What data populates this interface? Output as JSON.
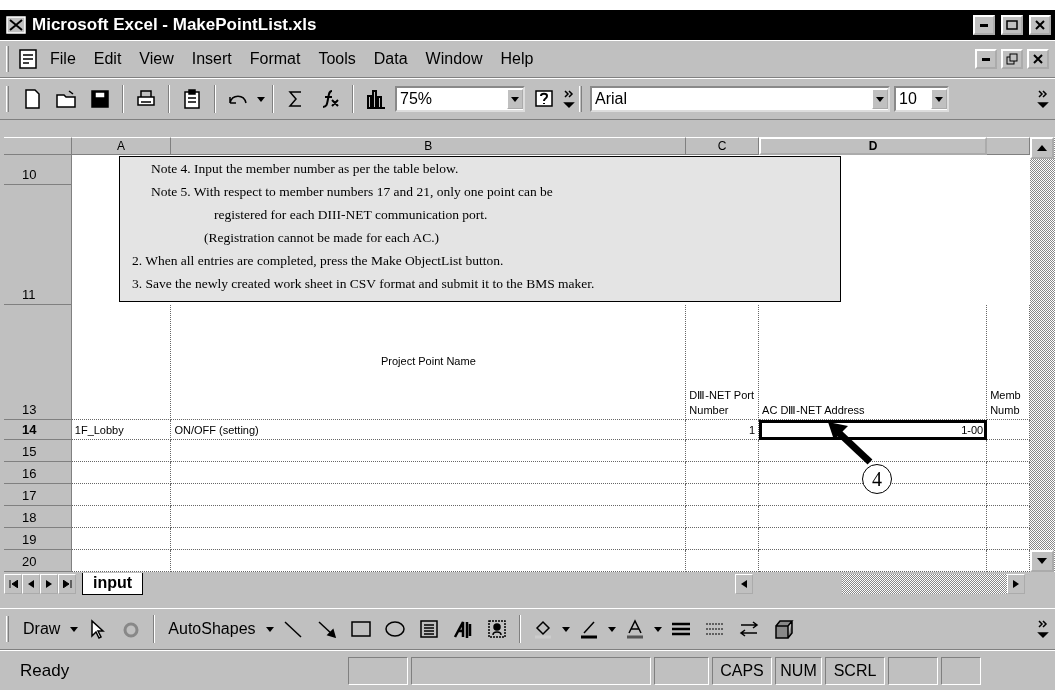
{
  "window": {
    "title": "Microsoft Excel - MakePointList.xls"
  },
  "menu": [
    "File",
    "Edit",
    "View",
    "Insert",
    "Format",
    "Tools",
    "Data",
    "Window",
    "Help"
  ],
  "toolbar": {
    "zoom": "75%",
    "font": "Arial",
    "font_size": "10"
  },
  "columns": [
    {
      "label": "A",
      "selected": false
    },
    {
      "label": "B",
      "selected": false
    },
    {
      "label": "C",
      "selected": false
    },
    {
      "label": "D",
      "selected": true
    },
    {
      "selected": false
    }
  ],
  "rows": [
    {
      "header": "10",
      "kind": "note",
      "selected": false
    },
    {
      "header": "11",
      "kind": "note",
      "selected": false
    },
    {
      "header": "13",
      "kind": "heading",
      "selected": false,
      "cells": [
        {
          "selected": false
        },
        {
          "text": "Project Point Name",
          "selected": false
        },
        {
          "text": "DⅢ-NET Port Number",
          "selected": false
        },
        {
          "text": "AC DⅢ-NET Address",
          "selected": false
        },
        {
          "text": "Memb Numb",
          "selected": false
        }
      ]
    },
    {
      "header": "14",
      "kind": "data",
      "selected": true,
      "cells": [
        {
          "text": "1F_Lobby",
          "selected": false
        },
        {
          "text": "ON/OFF (setting)",
          "selected": false
        },
        {
          "text": "1",
          "selected": false
        },
        {
          "text": "1-00",
          "selected": true
        },
        {
          "selected": false
        }
      ]
    },
    {
      "header": "15",
      "kind": "empty",
      "selected": false
    },
    {
      "header": "16",
      "kind": "empty",
      "selected": false
    },
    {
      "header": "17",
      "kind": "empty",
      "selected": false
    },
    {
      "header": "18",
      "kind": "empty",
      "selected": false
    },
    {
      "header": "19",
      "kind": "empty",
      "selected": false
    },
    {
      "header": "20",
      "kind": "empty",
      "selected": false
    }
  ],
  "note_box": [
    {
      "kind": "note",
      "text": "Note 4. Input the member number as per the table below."
    },
    {
      "kind": "note",
      "text": "Note 5. With respect to member numbers 17 and 21, only one point can be"
    },
    {
      "kind": "continuation",
      "text": "registered for each DIII-NET communication port."
    },
    {
      "kind": "aside",
      "text": "(Registration cannot be made for each AC.)"
    },
    {
      "kind": "step",
      "text": "2. When all entries are completed, press the Make ObjectList button."
    },
    {
      "kind": "step",
      "text": "3. Save the newly created work sheet in CSV format and submit it to the BMS maker."
    }
  ],
  "callout": {
    "label": "4"
  },
  "sheet_tabs": [
    {
      "label": "input",
      "selected": true
    }
  ],
  "draw_toolbar": {
    "draw": "Draw",
    "autoshapes": "AutoShapes"
  },
  "status_bar": {
    "text": "Ready",
    "indicators": [
      "CAPS",
      "NUM",
      "SCRL"
    ]
  }
}
